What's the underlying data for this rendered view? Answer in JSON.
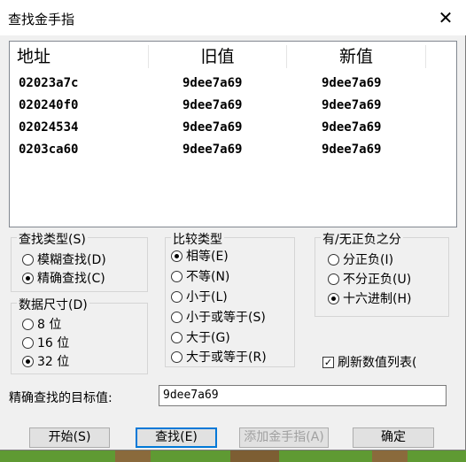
{
  "window": {
    "title": "查找金手指",
    "close": "✕"
  },
  "list": {
    "headers": [
      "地址",
      "旧值",
      "新值"
    ],
    "rows": [
      [
        "02023a7c",
        "9dee7a69",
        "9dee7a69"
      ],
      [
        "020240f0",
        "9dee7a69",
        "9dee7a69"
      ],
      [
        "02024534",
        "9dee7a69",
        "9dee7a69"
      ],
      [
        "0203ca60",
        "9dee7a69",
        "9dee7a69"
      ]
    ]
  },
  "search_type": {
    "title": "查找类型(S)",
    "fuzzy": "模糊查找(D)",
    "exact": "精确查找(C)",
    "selected": "exact"
  },
  "data_size": {
    "title": "数据尺寸(D)",
    "bit8": "8 位",
    "bit16": "16 位",
    "bit32": "32 位",
    "selected": "32"
  },
  "compare_type": {
    "title": "比较类型",
    "equal": "相等(E)",
    "not_equal": "不等(N)",
    "less": "小于(L)",
    "less_equal": "小于或等于(S)",
    "greater": "大于(G)",
    "greater_equal": "大于或等于(R)",
    "selected": "equal"
  },
  "sign": {
    "title": "有/无正负之分",
    "unsigned": "分正负(I)",
    "signed": "不分正负(U)",
    "hex": "十六进制(H)",
    "selected": "hex"
  },
  "refresh": {
    "label": "刷新数值列表(",
    "checked": true
  },
  "target": {
    "label": "精确查找的目标值:",
    "value": "9dee7a69"
  },
  "buttons": {
    "start": "开始(S)",
    "find": "查找(E)",
    "add": "添加金手指(A)",
    "ok": "确定"
  }
}
